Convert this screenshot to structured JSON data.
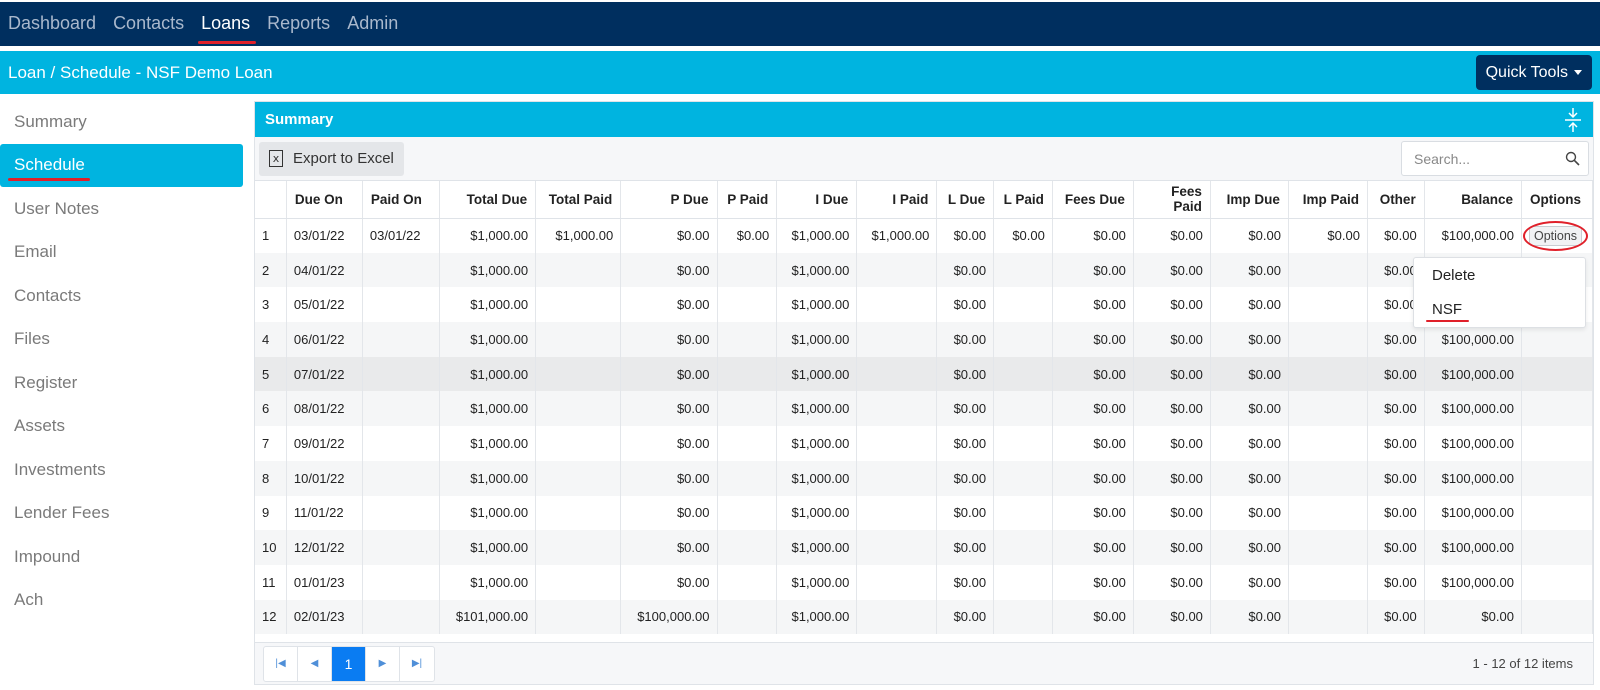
{
  "nav": {
    "items": [
      "Dashboard",
      "Contacts",
      "Loans",
      "Reports",
      "Admin"
    ],
    "active": "Loans"
  },
  "titlebar": {
    "title": "Loan / Schedule - NSF Demo Loan",
    "quick_tools": "Quick Tools"
  },
  "sidebar": {
    "items": [
      "Summary",
      "Schedule",
      "User Notes",
      "Email",
      "Contacts",
      "Files",
      "Register",
      "Assets",
      "Investments",
      "Lender Fees",
      "Impound",
      "Ach"
    ],
    "active": "Schedule"
  },
  "panel": {
    "title": "Summary",
    "export_label": "Export to Excel",
    "search_placeholder": "Search..."
  },
  "table": {
    "columns": [
      "",
      "Due On",
      "Paid On",
      "Total Due",
      "Total Paid",
      "P Due",
      "P Paid",
      "I Due",
      "I Paid",
      "L Due",
      "L Paid",
      "Fees Due",
      "Fees Paid",
      "Imp Due",
      "Imp Paid",
      "Other",
      "Balance",
      "Options"
    ],
    "rows": [
      [
        "1",
        "03/01/22",
        "03/01/22",
        "$1,000.00",
        "$1,000.00",
        "$0.00",
        "$0.00",
        "$1,000.00",
        "$1,000.00",
        "$0.00",
        "$0.00",
        "$0.00",
        "$0.00",
        "$0.00",
        "$0.00",
        "$0.00",
        "$100,000.00",
        "Options"
      ],
      [
        "2",
        "04/01/22",
        "",
        "$1,000.00",
        "",
        "$0.00",
        "",
        "$1,000.00",
        "",
        "$0.00",
        "",
        "$0.00",
        "$0.00",
        "$0.00",
        "",
        "$0.00",
        "",
        ""
      ],
      [
        "3",
        "05/01/22",
        "",
        "$1,000.00",
        "",
        "$0.00",
        "",
        "$1,000.00",
        "",
        "$0.00",
        "",
        "$0.00",
        "$0.00",
        "$0.00",
        "",
        "$0.00",
        "",
        ""
      ],
      [
        "4",
        "06/01/22",
        "",
        "$1,000.00",
        "",
        "$0.00",
        "",
        "$1,000.00",
        "",
        "$0.00",
        "",
        "$0.00",
        "$0.00",
        "$0.00",
        "",
        "$0.00",
        "$100,000.00",
        ""
      ],
      [
        "5",
        "07/01/22",
        "",
        "$1,000.00",
        "",
        "$0.00",
        "",
        "$1,000.00",
        "",
        "$0.00",
        "",
        "$0.00",
        "$0.00",
        "$0.00",
        "",
        "$0.00",
        "$100,000.00",
        ""
      ],
      [
        "6",
        "08/01/22",
        "",
        "$1,000.00",
        "",
        "$0.00",
        "",
        "$1,000.00",
        "",
        "$0.00",
        "",
        "$0.00",
        "$0.00",
        "$0.00",
        "",
        "$0.00",
        "$100,000.00",
        ""
      ],
      [
        "7",
        "09/01/22",
        "",
        "$1,000.00",
        "",
        "$0.00",
        "",
        "$1,000.00",
        "",
        "$0.00",
        "",
        "$0.00",
        "$0.00",
        "$0.00",
        "",
        "$0.00",
        "$100,000.00",
        ""
      ],
      [
        "8",
        "10/01/22",
        "",
        "$1,000.00",
        "",
        "$0.00",
        "",
        "$1,000.00",
        "",
        "$0.00",
        "",
        "$0.00",
        "$0.00",
        "$0.00",
        "",
        "$0.00",
        "$100,000.00",
        ""
      ],
      [
        "9",
        "11/01/22",
        "",
        "$1,000.00",
        "",
        "$0.00",
        "",
        "$1,000.00",
        "",
        "$0.00",
        "",
        "$0.00",
        "$0.00",
        "$0.00",
        "",
        "$0.00",
        "$100,000.00",
        ""
      ],
      [
        "10",
        "12/01/22",
        "",
        "$1,000.00",
        "",
        "$0.00",
        "",
        "$1,000.00",
        "",
        "$0.00",
        "",
        "$0.00",
        "$0.00",
        "$0.00",
        "",
        "$0.00",
        "$100,000.00",
        ""
      ],
      [
        "11",
        "01/01/23",
        "",
        "$1,000.00",
        "",
        "$0.00",
        "",
        "$1,000.00",
        "",
        "$0.00",
        "",
        "$0.00",
        "$0.00",
        "$0.00",
        "",
        "$0.00",
        "$100,000.00",
        ""
      ],
      [
        "12",
        "02/01/23",
        "",
        "$101,000.00",
        "",
        "$100,000.00",
        "",
        "$1,000.00",
        "",
        "$0.00",
        "",
        "$0.00",
        "$0.00",
        "$0.00",
        "",
        "$0.00",
        "$0.00",
        ""
      ]
    ]
  },
  "dropdown": {
    "items": [
      "Delete",
      "NSF"
    ]
  },
  "pager": {
    "current_page": "1",
    "info": "1 - 12 of 12 items"
  },
  "colors": {
    "nav_bg": "#002f5f",
    "accent": "#00b4e0",
    "highlight": "#e0202a",
    "page_active": "#0a7cf2"
  }
}
